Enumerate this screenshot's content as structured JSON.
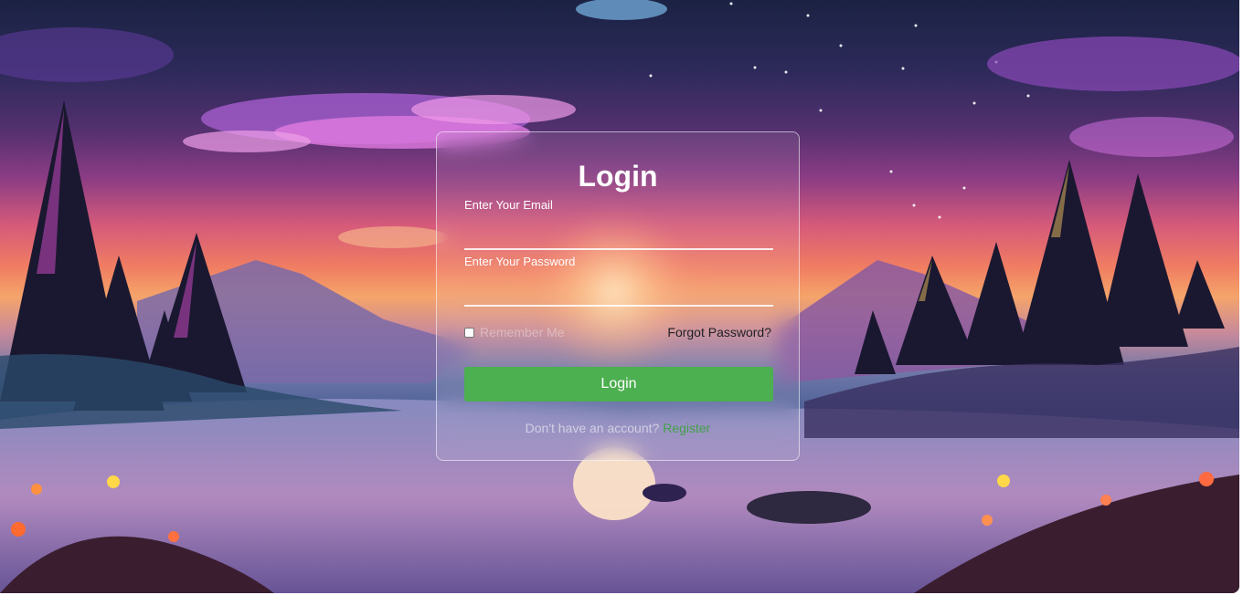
{
  "login_card": {
    "title": "Login",
    "email_label": "Enter Your Email",
    "email_value": "",
    "password_label": "Enter Your Password",
    "password_value": "",
    "remember_label": "Remember Me",
    "remember_checked": false,
    "forgot_label": "Forgot Password?",
    "submit_label": "Login",
    "register_prompt": "Don't have an account?",
    "register_link": "Register"
  },
  "colors": {
    "button_green": "#4caf50",
    "link_green": "#43a047",
    "card_border": "#ffffff"
  },
  "background": {
    "description_icon": "landscape-illustration"
  }
}
